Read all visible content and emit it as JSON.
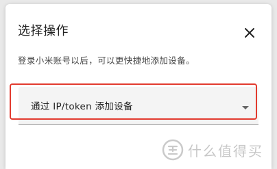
{
  "dialog": {
    "title": "选择操作",
    "subtitle": "登录小米账号以后，可以更快捷地添加设备。",
    "close_icon": "close-icon"
  },
  "select": {
    "value": "通过 IP/token 添加设备",
    "caret_icon": "dropdown-caret-icon"
  },
  "watermark": {
    "text": "什么值得买",
    "logo_icon": "zhi-logo-icon"
  },
  "colors": {
    "highlight": "#e23a2e",
    "select_bg": "#f4f4f4",
    "text": "#222222"
  }
}
